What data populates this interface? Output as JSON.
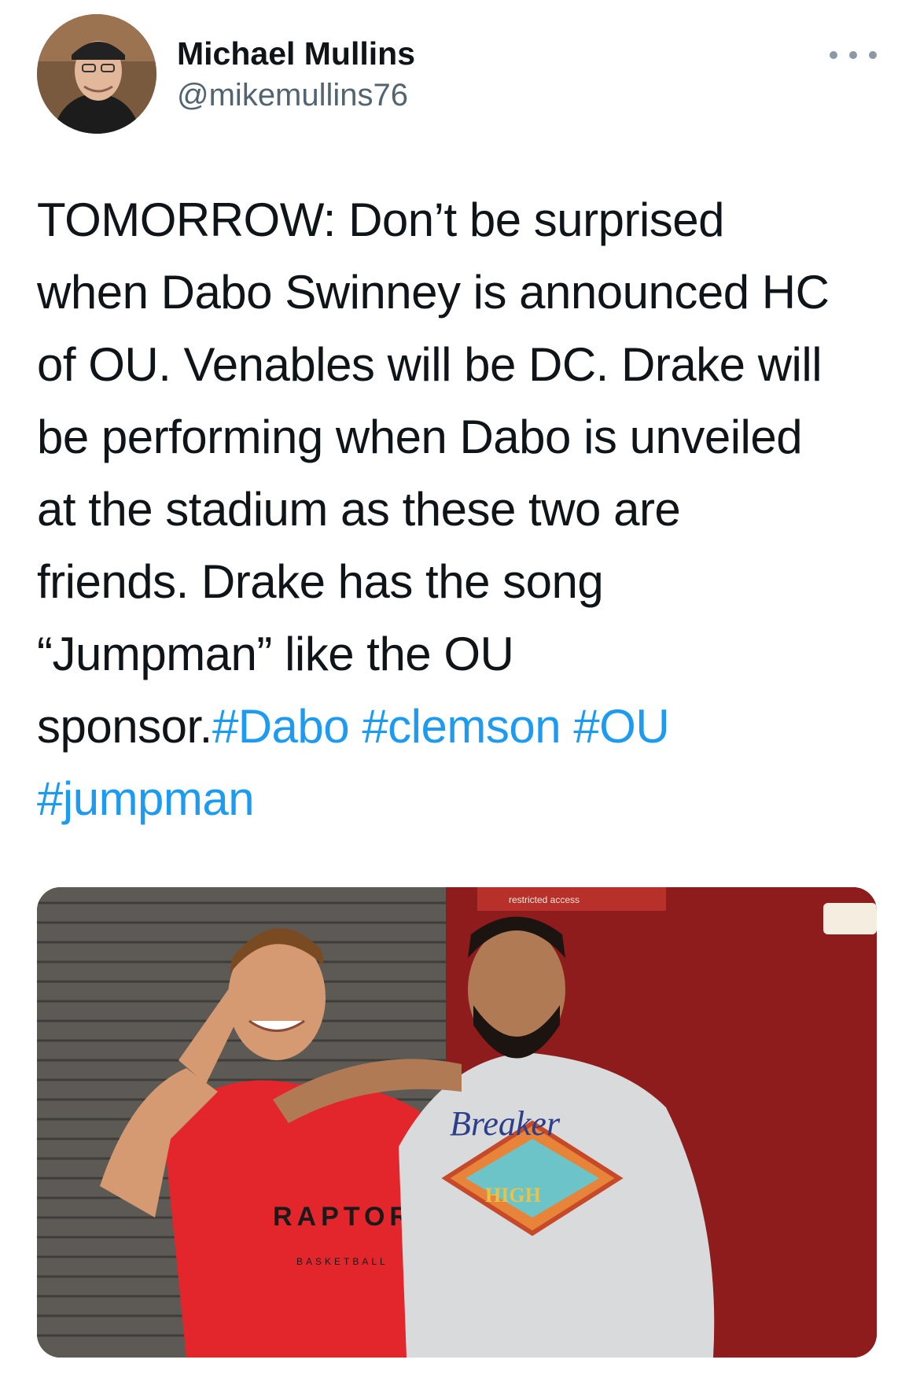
{
  "user": {
    "name": "Michael Mullins",
    "handle": "@mikemullins76"
  },
  "tweet": {
    "lines": [
      "TOMORROW: Don’t be surprised",
      "when Dabo Swinney is announced HC",
      "of OU. Venables will be DC. Drake will",
      "be performing when Dabo is unveiled",
      "at the stadium as these two are",
      "friends. Drake has the song",
      "“Jumpman” like the OU"
    ],
    "last_line_text": "sponsor.",
    "hashtags": [
      "#Dabo",
      "#clemson",
      "#OU",
      "#jumpman"
    ]
  },
  "media": {
    "shirt_text": "RAPTORS",
    "shirt_subtext": "BASKETBALL",
    "hoodie_text": "Breaker",
    "hoodie_subtext": "HIGH",
    "sign_text": "restricted access"
  },
  "icons": {
    "more": "more-options-icon"
  },
  "colors": {
    "hashtag": "#1d9bf0",
    "handle": "#536471",
    "text": "#0f1419"
  }
}
